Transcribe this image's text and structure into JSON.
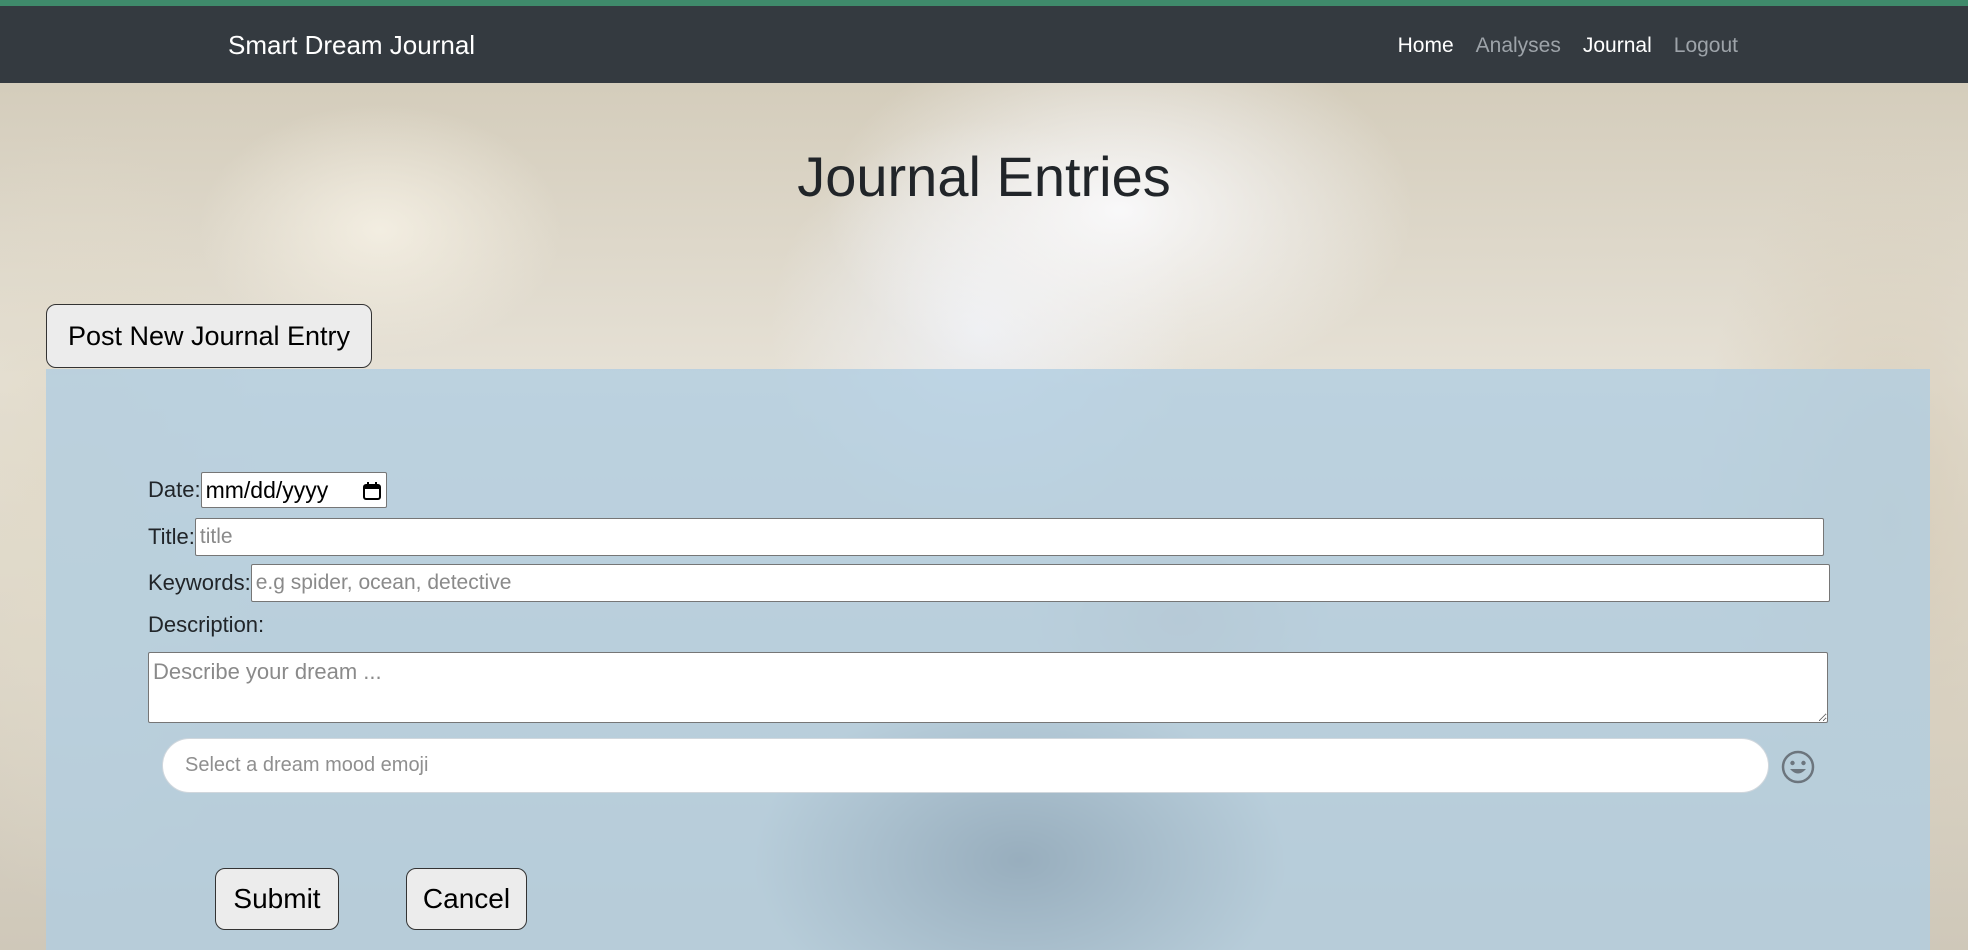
{
  "navbar": {
    "brand": "Smart Dream Journal",
    "links": [
      {
        "label": "Home",
        "state": "active"
      },
      {
        "label": "Analyses",
        "state": "muted"
      },
      {
        "label": "Journal",
        "state": "active"
      },
      {
        "label": "Logout",
        "state": "muted"
      }
    ]
  },
  "page": {
    "title": "Journal Entries",
    "post_button_label": "Post New Journal Entry"
  },
  "form": {
    "date_label": "Date:",
    "date_value": "mm/dd/yyyy",
    "title_label": "Title:",
    "title_placeholder": "title",
    "keywords_label": "Keywords:",
    "keywords_placeholder": "e.g spider, ocean, detective",
    "description_label": "Description:",
    "description_placeholder": "Describe your dream ...",
    "emoji_placeholder": "Select a dream mood emoji",
    "submit_label": "Submit",
    "cancel_label": "Cancel"
  },
  "icons": {
    "calendar": "calendar-icon",
    "emoji": "smiley-icon"
  },
  "colors": {
    "navbar_bg": "#343a40",
    "top_stripe": "#3f8a6b",
    "panel_bg": "#b0cde1"
  }
}
